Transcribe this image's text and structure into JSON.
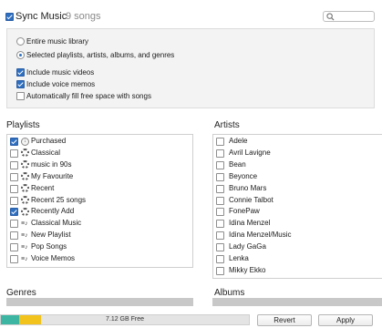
{
  "header": {
    "sync_label": "Sync Music",
    "sync_checked": true,
    "song_count": "9 songs"
  },
  "search": {
    "placeholder": ""
  },
  "sync_options": {
    "radios": [
      {
        "label": "Entire music library",
        "selected": false
      },
      {
        "label": "Selected playlists, artists, albums, and genres",
        "selected": true
      }
    ],
    "checkboxes": [
      {
        "label": "Include music videos",
        "checked": true
      },
      {
        "label": "Include voice memos",
        "checked": true
      },
      {
        "label": "Automatically fill free space with songs",
        "checked": false
      }
    ]
  },
  "playlists": {
    "title": "Playlists",
    "items": [
      {
        "label": "Purchased",
        "checked": true,
        "icon": "purchased-icon"
      },
      {
        "label": "Classical",
        "checked": false,
        "icon": "smart-playlist-gear-icon"
      },
      {
        "label": "music in 90s",
        "checked": false,
        "icon": "smart-playlist-gear-icon"
      },
      {
        "label": "My Favourite",
        "checked": false,
        "icon": "smart-playlist-gear-icon"
      },
      {
        "label": "Recent",
        "checked": false,
        "icon": "smart-playlist-gear-icon"
      },
      {
        "label": "Recent 25 songs",
        "checked": false,
        "icon": "smart-playlist-gear-icon"
      },
      {
        "label": "Recently Add",
        "checked": true,
        "icon": "smart-playlist-gear-icon"
      },
      {
        "label": "Classical Music",
        "checked": false,
        "icon": "playlist-icon"
      },
      {
        "label": "New Playlist",
        "checked": false,
        "icon": "playlist-icon"
      },
      {
        "label": "Pop Songs",
        "checked": false,
        "icon": "playlist-icon"
      },
      {
        "label": "Voice Memos",
        "checked": false,
        "icon": "playlist-icon"
      }
    ]
  },
  "artists": {
    "title": "Artists",
    "items": [
      {
        "label": "Adele",
        "checked": false
      },
      {
        "label": "Avril Lavigne",
        "checked": false
      },
      {
        "label": "Bean",
        "checked": false
      },
      {
        "label": "Beyonce",
        "checked": false
      },
      {
        "label": "Bruno Mars",
        "checked": false
      },
      {
        "label": "Connie Talbot",
        "checked": false
      },
      {
        "label": "FonePaw",
        "checked": false
      },
      {
        "label": "Idina Menzel",
        "checked": false
      },
      {
        "label": "Idina Menzel/Music",
        "checked": false
      },
      {
        "label": "Lady GaGa",
        "checked": false
      },
      {
        "label": "Lenka",
        "checked": false
      },
      {
        "label": "Mikky Ekko",
        "checked": false
      }
    ]
  },
  "genres": {
    "title": "Genres"
  },
  "albums": {
    "title": "Albums"
  },
  "storage": {
    "free_label": "7.12 GB Free",
    "colors": {
      "audio": "#3cb6a3",
      "other": "#f2c21d",
      "free": "#e4e4e4"
    },
    "segments": [
      {
        "name": "audio",
        "fraction": 0.075
      },
      {
        "name": "other",
        "fraction": 0.085
      }
    ]
  },
  "buttons": {
    "revert": "Revert",
    "apply": "Apply"
  }
}
